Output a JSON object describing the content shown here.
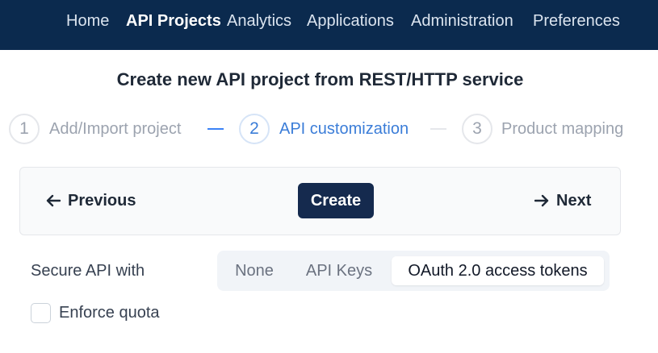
{
  "nav": {
    "items": [
      {
        "label": "Home",
        "active": false
      },
      {
        "label": "API Projects",
        "active": true
      },
      {
        "label": "Analytics",
        "active": false
      },
      {
        "label": "Applications",
        "active": false
      },
      {
        "label": "Administration",
        "active": false
      },
      {
        "label": "Preferences",
        "active": false
      }
    ]
  },
  "page_title": "Create new API project from REST/HTTP service",
  "stepper": {
    "steps": [
      {
        "number": "1",
        "label": "Add/Import project",
        "state": "done"
      },
      {
        "number": "2",
        "label": "API customization",
        "state": "active"
      },
      {
        "number": "3",
        "label": "Product mapping",
        "state": "todo"
      }
    ]
  },
  "actions": {
    "previous_label": "Previous",
    "create_label": "Create",
    "next_label": "Next"
  },
  "secure": {
    "label": "Secure API with",
    "options": [
      "None",
      "API Keys",
      "OAuth 2.0 access tokens"
    ],
    "selected": "OAuth 2.0 access tokens"
  },
  "quota": {
    "label": "Enforce quota",
    "checked": false
  },
  "colors": {
    "nav_bg": "#0b2a4e",
    "accent": "#3b7dd8",
    "primary_button": "#152a4e"
  }
}
